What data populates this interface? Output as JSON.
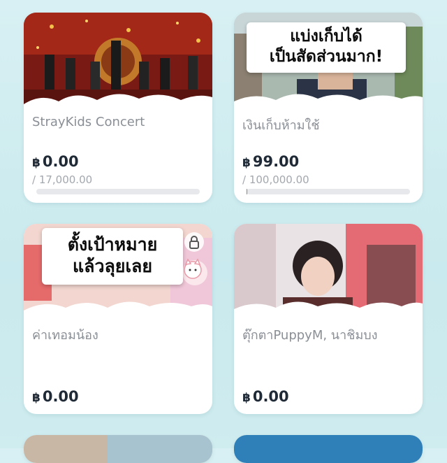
{
  "currency_symbol": "฿",
  "accent_color": "#2aa7c4",
  "cards": [
    {
      "title": "StrayKids Concert",
      "amount": "0.00",
      "target": "/ 17,000.00",
      "progress": 0.0
    },
    {
      "title": "เงินเก็บห้ามใช้",
      "amount": "99.00",
      "target": "/ 100,000.00",
      "progress": 0.001,
      "overlay_line1": "แบ่งเก็บได้",
      "overlay_line2": "เป็นสัดส่วนมาก!"
    },
    {
      "title": "ค่าเทอมน้อง",
      "amount": "0.00",
      "overlay_line1": "ตั้งเป้าหมาย",
      "overlay_line2": "แล้วลุยเลย",
      "icons": [
        "lock-icon",
        "cat-sticker-icon"
      ]
    },
    {
      "title": "ตุ๊กตาPuppyM, นาชิมบง",
      "amount": "0.00"
    }
  ]
}
